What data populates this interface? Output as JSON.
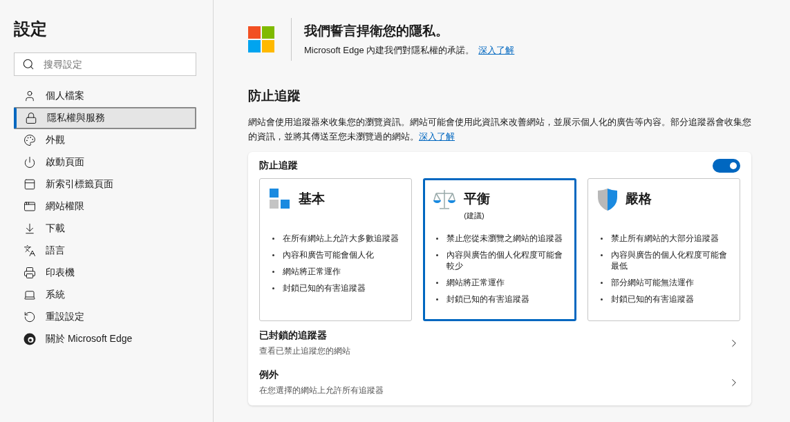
{
  "sidebar": {
    "title": "設定",
    "search": {
      "placeholder": "搜尋設定"
    },
    "items": [
      {
        "label": "個人檔案",
        "selected": false
      },
      {
        "label": "隱私權與服務",
        "selected": true
      },
      {
        "label": "外觀",
        "selected": false
      },
      {
        "label": "啟動頁面",
        "selected": false
      },
      {
        "label": "新索引標籤頁面",
        "selected": false
      },
      {
        "label": "網站權限",
        "selected": false
      },
      {
        "label": "下載",
        "selected": false
      },
      {
        "label": "語言",
        "selected": false
      },
      {
        "label": "印表機",
        "selected": false
      },
      {
        "label": "系統",
        "selected": false
      },
      {
        "label": "重設設定",
        "selected": false
      },
      {
        "label": "關於 Microsoft Edge",
        "selected": false
      }
    ]
  },
  "banner": {
    "title": "我們誓言捍衛您的隱私。",
    "text": "Microsoft Edge 內建我們對隱私權的承諾。",
    "link": "深入了解"
  },
  "section": {
    "title": "防止追蹤",
    "text": "網站會使用追蹤器來收集您的瀏覽資訊。網站可能會使用此資訊來改善網站，並展示個人化的廣告等內容。部分追蹤器會收集您的資訊，並將其傳送至您未瀏覽過的網站。",
    "link": "深入了解"
  },
  "panel": {
    "label": "防止追蹤",
    "on": true,
    "cards": [
      {
        "kind": "basic",
        "title": "基本",
        "selected": false,
        "bullets": [
          "在所有網站上允許大多數追蹤器",
          "內容和廣告可能會個人化",
          "網站將正常運作",
          "封鎖已知的有害追蹤器"
        ]
      },
      {
        "kind": "balanced",
        "title": "平衡",
        "subtitle": "(建議)",
        "selected": true,
        "bullets": [
          "禁止您從未瀏覽之網站的追蹤器",
          "內容與廣告的個人化程度可能會較少",
          "網站將正常運作",
          "封鎖已知的有害追蹤器"
        ]
      },
      {
        "kind": "strict",
        "title": "嚴格",
        "selected": false,
        "bullets": [
          "禁止所有網站的大部分追蹤器",
          "內容與廣告的個人化程度可能會最低",
          "部分網站可能無法運作",
          "封鎖已知的有害追蹤器"
        ]
      }
    ],
    "links": [
      {
        "title": "已封鎖的追蹤器",
        "text": "查看已禁止追蹤您的網站"
      },
      {
        "title": "例外",
        "text": "在您選擇的網站上允許所有追蹤器"
      }
    ]
  }
}
